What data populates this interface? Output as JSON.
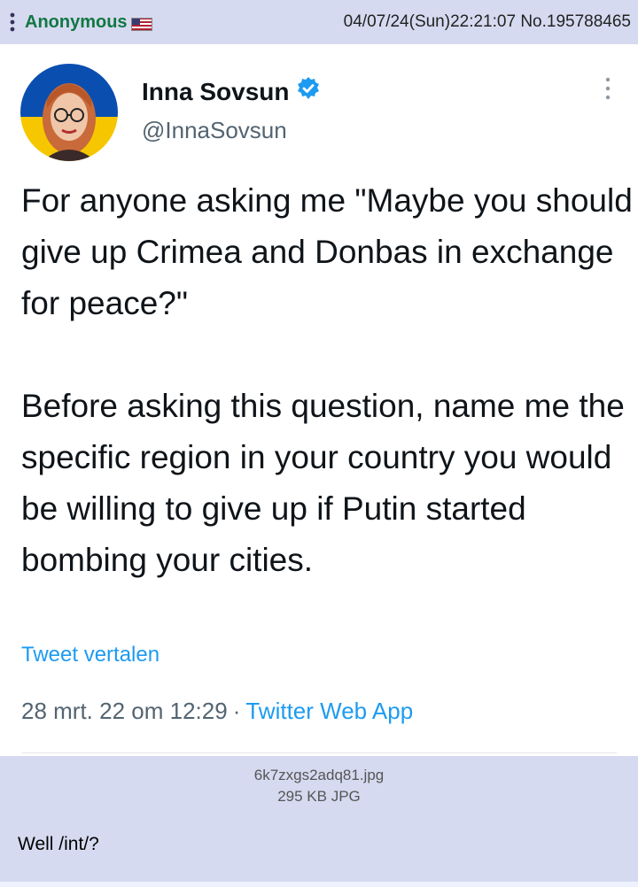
{
  "post": {
    "name": "Anonymous",
    "date_time": "04/07/24(Sun)22:21:07",
    "number_label": "No.195788465",
    "menu_icon": "kebab-menu-icon",
    "flag_icon": "us-flag-icon"
  },
  "tweet": {
    "author_name": "Inna Sovsun",
    "handle": "@InnaSovsun",
    "verified_icon": "verified-badge-icon",
    "paragraphs": [
      "For anyone asking me \"Maybe you should give up Crimea and Donbas in exchange for peace?\"",
      "Before asking this question, name me the specific region in your country you would be willing to give up if Putin started bombing your cities."
    ],
    "translate_label": "Tweet vertalen",
    "date": "28 mrt. 22 om 12:29",
    "separator": "·",
    "source": "Twitter Web App",
    "colors": {
      "link": "#1d9bf0",
      "text": "#0f1419",
      "secondary": "#536471"
    }
  },
  "attachment": {
    "filename": "6k7zxgs2adq81.jpg",
    "details": "295 KB JPG"
  },
  "comment": {
    "text": "Well /int/?"
  },
  "colors": {
    "post_background": "#d6daf0",
    "name_green": "#117743"
  }
}
